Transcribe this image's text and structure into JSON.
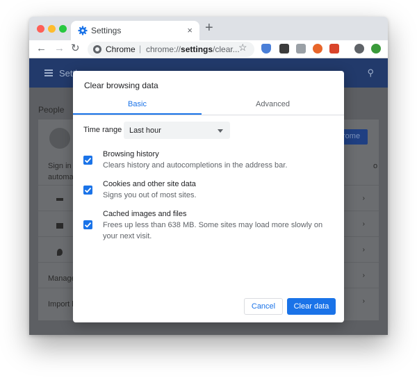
{
  "browser": {
    "tab_title": "Settings",
    "tab_close": "×",
    "new_tab": "+",
    "nav": {
      "back": "←",
      "forward": "→",
      "reload": "↻"
    },
    "omnibox": {
      "site_label": "Chrome",
      "separator": "|",
      "url_prefix": "chrome://",
      "url_bold": "settings",
      "url_suffix": "/clear..."
    },
    "bookmark_star": "☆",
    "extensions": [
      {
        "name": "shield-extension-icon",
        "color": "#4a7fd8"
      },
      {
        "name": "m-extension-icon",
        "color": "#3c3c3c"
      },
      {
        "name": "ps-extension-icon",
        "color": "#9aa0a6"
      },
      {
        "name": "gear-extension-icon",
        "color": "#e8662a"
      },
      {
        "name": "bracket-extension-icon",
        "color": "#d9442b"
      },
      {
        "name": "profile-icon",
        "color": "#5f6368"
      },
      {
        "name": "update-icon",
        "color": "#3a9a3a"
      }
    ]
  },
  "page": {
    "header_text": "Setti",
    "people_label": "People",
    "card_button": "rome",
    "sign_in_line1": "Sign in t",
    "sign_in_line2": "automa",
    "side_text": "o",
    "row_manage": "Manage",
    "row_import": "Import b"
  },
  "dialog": {
    "title": "Clear browsing data",
    "tabs": [
      {
        "label": "Basic",
        "active": true
      },
      {
        "label": "Advanced",
        "active": false
      }
    ],
    "time_range_label": "Time range",
    "time_range_value": "Last hour",
    "items": [
      {
        "title": "Browsing history",
        "description": "Clears history and autocompletions in the address bar.",
        "checked": true
      },
      {
        "title": "Cookies and other site data",
        "description": "Signs you out of most sites.",
        "checked": true
      },
      {
        "title": "Cached images and files",
        "description": "Frees up less than 638 MB. Some sites may load more slowly on your next visit.",
        "checked": true
      }
    ],
    "cancel_label": "Cancel",
    "confirm_label": "Clear data",
    "accent_color": "#1a73e8"
  }
}
